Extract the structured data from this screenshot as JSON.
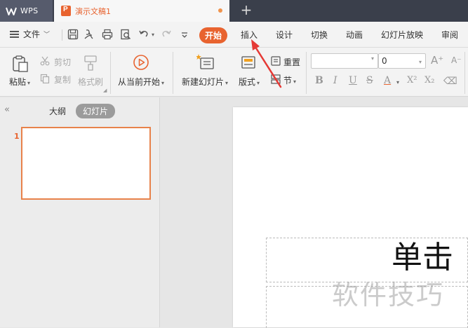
{
  "titlebar": {
    "app_label": "WPS",
    "doc_tab_title": "演示文稿1",
    "new_tab": "+"
  },
  "menubar": {
    "file_label": "文件",
    "tabs": [
      "开始",
      "插入",
      "设计",
      "切换",
      "动画",
      "幻灯片放映",
      "审阅"
    ],
    "active_tab": "开始"
  },
  "ribbon": {
    "paste": "粘贴",
    "cut": "剪切",
    "copy": "复制",
    "format_painter": "格式刷",
    "from_current": "从当前开始",
    "new_slide": "新建幻灯片",
    "layout": "版式",
    "reset": "重置",
    "section": "节",
    "font_name": "",
    "font_size": "0"
  },
  "left_panel": {
    "tab_outline": "大纲",
    "tab_slides": "幻灯片",
    "slide_number": "1"
  },
  "slide": {
    "title_partial": "单击"
  },
  "watermark": "软件技巧",
  "colors": {
    "accent": "#e8632f",
    "titlebar": "#3a3f4b",
    "annotation": "#e53935"
  }
}
